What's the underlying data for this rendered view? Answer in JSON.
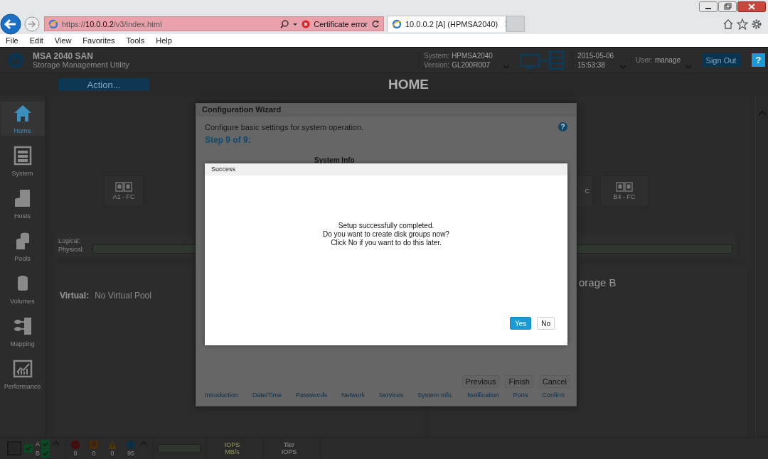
{
  "browser": {
    "address": "https://**10.0.0.2**/v3/index.html",
    "certificate_error": "Certificate error",
    "tabs": [
      {
        "title": "10.0.0.2 [A] (HPMSA2040)",
        "selected": true
      }
    ],
    "menu": [
      "File",
      "Edit",
      "View",
      "Favorites",
      "Tools",
      "Help"
    ]
  },
  "app": {
    "product": "MSA 2040 SAN",
    "subtitle": "Storage Management Utility",
    "system_label": "System:",
    "system": "HPMSA2040",
    "version_label": "Version:",
    "version": "GL200R007",
    "date": "2015-05-06",
    "time": "15:53:38",
    "user_label": "User:",
    "user": "manage",
    "sign_out": "Sign Out",
    "help": "?",
    "action": "Action...",
    "page_title": "HOME"
  },
  "sidebar": [
    {
      "label": "Home",
      "kind": "home",
      "selected": true
    },
    {
      "label": "System",
      "kind": "system",
      "selected": false
    },
    {
      "label": "Hosts",
      "kind": "hosts",
      "selected": false
    },
    {
      "label": "Pools",
      "kind": "pools",
      "selected": false
    },
    {
      "label": "Volumes",
      "kind": "volumes",
      "selected": false
    },
    {
      "label": "Mapping",
      "kind": "mapping",
      "selected": false
    },
    {
      "label": "Performance",
      "kind": "performance",
      "selected": false
    }
  ],
  "home": {
    "ports": [
      {
        "label": "A1 - FC"
      },
      {
        "label": "C"
      },
      {
        "label": "B4 - FC"
      }
    ],
    "logical_label": "Logical:",
    "physical_label": "Physical:",
    "virtual_label": "Virtual:",
    "virtual_value": "No Virtual Pool",
    "storage_label": "orage B"
  },
  "status_bar": {
    "controllers": [
      {
        "label": "A",
        "ok": true
      },
      {
        "label": "B",
        "ok": true
      }
    ],
    "events": [
      {
        "kind": "critical",
        "count": "0"
      },
      {
        "kind": "error",
        "count": "0"
      },
      {
        "kind": "warning",
        "count": "0"
      },
      {
        "kind": "info",
        "count": "95"
      }
    ],
    "io_labels": [
      "IOPS",
      "MB/s"
    ],
    "tier_labels": [
      "Tier",
      "IOPS"
    ]
  },
  "wizard": {
    "title": "Configuration Wizard",
    "description": "Configure basic settings for system operation.",
    "help": "?",
    "step": "Step 9 of 9:",
    "section_title": "System Info",
    "buttons": [
      "Previous",
      "Finish",
      "Cancel"
    ],
    "steps": [
      "Introduction",
      "Date/Time",
      "Passwords",
      "Network",
      "Services",
      "System Info.",
      "Notification",
      "Ports",
      "Confirm"
    ]
  },
  "dialog": {
    "title": "Success",
    "message": [
      "Setup successfully completed.",
      "Do you want to create disk groups now?",
      "Click No if you want to do this later."
    ],
    "buttons": [
      {
        "label": "Yes",
        "primary": true
      },
      {
        "label": "No",
        "primary": false
      }
    ]
  }
}
